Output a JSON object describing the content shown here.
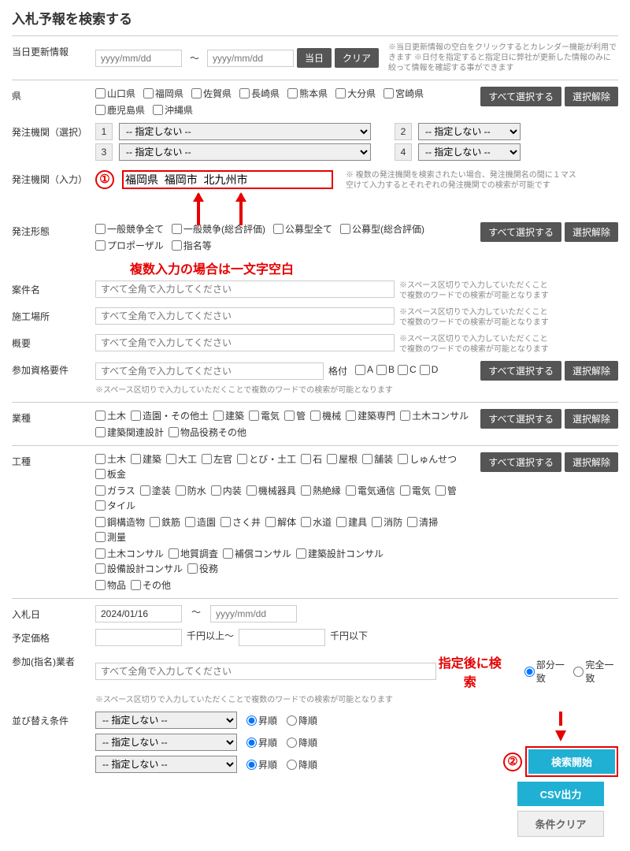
{
  "title": "入札予報を検索する",
  "update": {
    "label": "当日更新情報",
    "from_ph": "yyyy/mm/dd",
    "to_ph": "yyyy/mm/dd",
    "btn_today": "当日",
    "btn_clear": "クリア",
    "help": "※当日更新情報の空白をクリックするとカレンダー機能が利用できます\n※日付を指定すると指定日に弊社が更新した情報のみに絞って情報を確認する事ができます"
  },
  "pref": {
    "label": "県",
    "items": [
      "山口県",
      "福岡県",
      "佐賀県",
      "長崎県",
      "熊本県",
      "大分県",
      "宮崎県",
      "鹿児島県",
      "沖縄県"
    ],
    "btn_all": "すべて選択する",
    "btn_none": "選択解除"
  },
  "agency_select": {
    "label": "発注機関（選択）",
    "nums": [
      "1",
      "2",
      "3",
      "4"
    ],
    "opt_none": "-- 指定しない --"
  },
  "agency_input": {
    "label": "発注機関（入力）",
    "value": "福岡県  福岡市  北九州市",
    "hint": "※ 複数の発注機関を検索されたい場合、発注機関名の間に１マス空けて入力するとそれぞれの発注機関での検索が可能です",
    "circled": "①",
    "annot": "複数入力の場合は一文字空白"
  },
  "form": {
    "label": "発注形態",
    "items": [
      "一般競争全て",
      "一般競争(総合評価)",
      "公募型全て",
      "公募型(総合評価)",
      "プロポーザル",
      "指名等"
    ],
    "btn_all": "すべて選択する",
    "btn_none": "選択解除"
  },
  "name": {
    "label": "案件名",
    "ph": "すべて全角で入力してください",
    "hint": "※スペース区切りで入力していただくことで複数のワードでの検索が可能となります"
  },
  "place": {
    "label": "施工場所",
    "ph": "すべて全角で入力してください",
    "hint": "※スペース区切りで入力していただくことで複数のワードでの検索が可能となります"
  },
  "summary": {
    "label": "概要",
    "ph": "すべて全角で入力してください",
    "hint": "※スペース区切りで入力していただくことで複数のワードでの検索が可能となります"
  },
  "qual": {
    "label": "参加資格要件",
    "ph": "すべて全角で入力してください",
    "grade_label": "格付",
    "grades": [
      "A",
      "B",
      "C",
      "D"
    ],
    "btn_all": "すべて選択する",
    "btn_none": "選択解除",
    "hint": "※スペース区切りで入力していただくことで複数のワードでの検索が可能となります"
  },
  "industry": {
    "label": "業種",
    "row1": [
      "土木",
      "造園・その他土",
      "建築",
      "電気",
      "管",
      "機械",
      "建築専門",
      "土木コンサル"
    ],
    "row2": [
      "建築関連設計",
      "物品役務その他"
    ],
    "btn_all": "すべて選択する",
    "btn_none": "選択解除"
  },
  "worktype": {
    "label": "工種",
    "rows": [
      [
        "土木",
        "建築",
        "大工",
        "左官",
        "とび・土工",
        "石",
        "屋根",
        "舗装",
        "しゅんせつ",
        "板金"
      ],
      [
        "ガラス",
        "塗装",
        "防水",
        "内装",
        "機械器具",
        "熱絶縁",
        "電気通信",
        "電気",
        "管",
        "タイル"
      ],
      [
        "鋼構造物",
        "鉄筋",
        "造園",
        "さく井",
        "解体",
        "水道",
        "建具",
        "消防",
        "清掃",
        "測量"
      ],
      [
        "土木コンサル",
        "地質調査",
        "補償コンサル",
        "建築設計コンサル",
        "設備設計コンサル",
        "役務"
      ],
      [
        "物品",
        "その他"
      ]
    ],
    "btn_all": "すべて選択する",
    "btn_none": "選択解除"
  },
  "bid_date": {
    "label": "入札日",
    "from": "2024/01/16",
    "to_ph": "yyyy/mm/dd"
  },
  "price": {
    "label": "予定価格",
    "unit_from": "千円以上～",
    "unit_to": "千円以下"
  },
  "nominee": {
    "label": "参加(指名)業者",
    "ph": "すべて全角で入力してください",
    "r1": "部分一致",
    "r2": "完全一致",
    "hint": "※スペース区切りで入力していただくことで複数のワードでの検索が可能となります"
  },
  "sort": {
    "label": "並び替え条件",
    "opt_none": "-- 指定しない --",
    "asc": "昇順",
    "desc": "降順"
  },
  "actions": {
    "circled": "②",
    "annot": "指定後に検索",
    "search": "検索開始",
    "csv": "CSV出力",
    "clear": "条件クリア"
  }
}
